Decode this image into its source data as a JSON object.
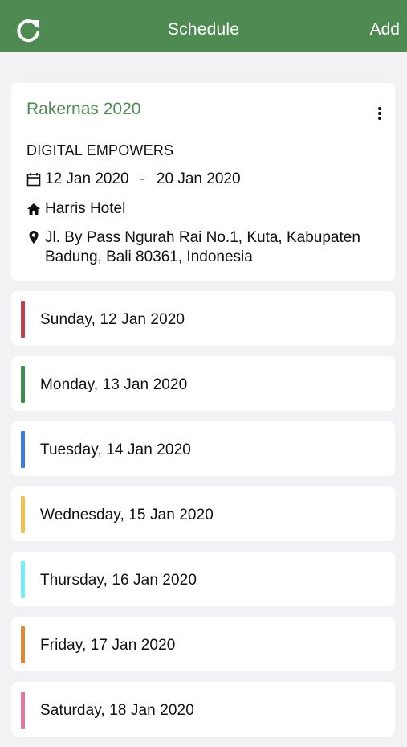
{
  "header": {
    "title": "Schedule",
    "add_label": "Add",
    "refresh_icon": "refresh-icon"
  },
  "event": {
    "title": "Rakernas 2020",
    "organization": "DIGITAL EMPOWERS",
    "start_date": "12 Jan 2020",
    "date_separator": "-",
    "end_date": "20 Jan 2020",
    "venue": "Harris Hotel",
    "address_line1": "Jl. By Pass Ngurah Rai No.1, Kuta, Kabupaten",
    "address_line2": "Badung, Bali 80361, Indonesia"
  },
  "days": [
    {
      "label": "Sunday, 12 Jan 2020",
      "color": "#c0404d"
    },
    {
      "label": "Monday, 13 Jan 2020",
      "color": "#3f8a50"
    },
    {
      "label": "Tuesday, 14 Jan 2020",
      "color": "#3e7be0"
    },
    {
      "label": "Wednesday, 15 Jan 2020",
      "color": "#f0c24a"
    },
    {
      "label": "Thursday, 16 Jan 2020",
      "color": "#6ff0f5"
    },
    {
      "label": "Friday, 17 Jan 2020",
      "color": "#e08733"
    },
    {
      "label": "Saturday, 18 Jan 2020",
      "color": "#e4779a"
    }
  ],
  "colors": {
    "brand_green": "#4f8a52",
    "background": "#f2f2f4"
  }
}
